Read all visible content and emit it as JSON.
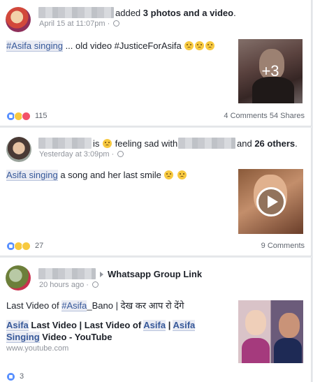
{
  "posts": [
    {
      "header_action": "added",
      "header_bold": "3 photos and a video",
      "header_end": ".",
      "time": "April 15 at 11:07pm",
      "text_hashtag": "#Asifa singing",
      "text_rest": " ... old video #JusticeForAsifa",
      "media_more": "+3",
      "reaction_count": "115",
      "comments": "4 Comments",
      "shares": "54 Shares"
    },
    {
      "header_is": "is",
      "header_feeling": "feeling sad with",
      "header_others": "26 others",
      "header_end": ".",
      "time": "Yesterday at 3:09pm",
      "text_highlight": "Asifa singing",
      "text_rest": " a song and her last smile",
      "reaction_count": "27",
      "comments": "9 Comments"
    },
    {
      "group": "Whatsapp Group Link",
      "time": "20 hours ago",
      "text_pre": "Last Video of ",
      "text_hashtag": "#Asifa",
      "text_post": "_Bano | देख कर आप रो देंगे",
      "link_title_1": "Asifa",
      "link_title_2": " Last Video | Last Video of ",
      "link_title_3": "Asifa",
      "link_title_4": " | ",
      "link_title_5": "Asifa",
      "link_title_6": "Singing",
      "link_title_7": " Video - YouTube",
      "link_url": "www.youtube.com",
      "reaction_count": "3"
    }
  ],
  "colors": {
    "link": "#365899",
    "muted": "#90949c",
    "like": "#5890ff"
  }
}
